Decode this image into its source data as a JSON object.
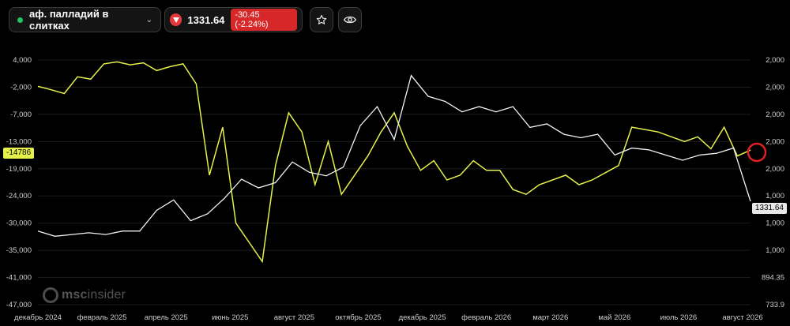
{
  "header": {
    "instrument": "аф. палладий в слитках",
    "price": "1331.64",
    "change": "-30.45 (-2.24%)",
    "colors": {
      "status_dot": "#22c55e",
      "negative": "#d62828"
    },
    "icons": [
      "chevron-down-icon",
      "down-arrow-icon",
      "star-icon",
      "eye-icon"
    ]
  },
  "watermark": {
    "brand": "msc",
    "brand_rest": "insider"
  },
  "current_labels": {
    "left": "-14786",
    "right": "1331.64"
  },
  "chart_data": {
    "type": "line",
    "x_ticks": [
      "декабрь 2024",
      "февраль 2025",
      "апрель 2025",
      "июнь 2025",
      "август 2025",
      "октябрь 2025",
      "декабрь 2025",
      "февраль 2026",
      "март 2026",
      "май 2026",
      "июль 2026",
      "август 2026"
    ],
    "y_left_ticks": [
      "4,000",
      "-2,000",
      "-7,000",
      "-13,000",
      "-19,000",
      "-24,000",
      "-30,000",
      "-35,000",
      "-41,000",
      "-47,000"
    ],
    "y_right_ticks": [
      "2,000",
      "2,000",
      "2,000",
      "2,000",
      "2,000",
      "1,000",
      "1,000",
      "1,000",
      "894.35",
      "733.9"
    ],
    "ylim_left": [
      -47000,
      4000
    ],
    "series": [
      {
        "axis": "left",
        "color": "#e6f04a",
        "values": [
          -1500,
          -2200,
          -3000,
          500,
          0,
          3200,
          3600,
          3000,
          3400,
          1800,
          2600,
          3200,
          -1000,
          -20000,
          -10000,
          -30000,
          -34000,
          -38000,
          -18000,
          -7000,
          -11000,
          -22000,
          -13000,
          -24000,
          -20000,
          -16000,
          -11000,
          -7000,
          -14000,
          -19000,
          -17000,
          -21000,
          -20000,
          -17000,
          -19000,
          -19000,
          -23000,
          -24000,
          -22000,
          -21000,
          -20000,
          -22000,
          -21000,
          -19500,
          -18000,
          -10000,
          -10500,
          -11000,
          -12000,
          -13000,
          -12000,
          -14500,
          -10000,
          -16000,
          -14786
        ]
      },
      {
        "axis": "right",
        "color": "#f2f2f2",
        "values": [
          1160,
          1130,
          1140,
          1150,
          1140,
          1160,
          1160,
          1280,
          1340,
          1220,
          1260,
          1350,
          1460,
          1410,
          1440,
          1560,
          1500,
          1480,
          1530,
          1770,
          1880,
          1690,
          2060,
          1940,
          1910,
          1850,
          1880,
          1850,
          1880,
          1760,
          1780,
          1720,
          1700,
          1720,
          1600,
          1640,
          1630,
          1600,
          1570,
          1600,
          1610,
          1640,
          1331.64
        ]
      }
    ],
    "annotations": [
      "red-circle-marker"
    ]
  }
}
